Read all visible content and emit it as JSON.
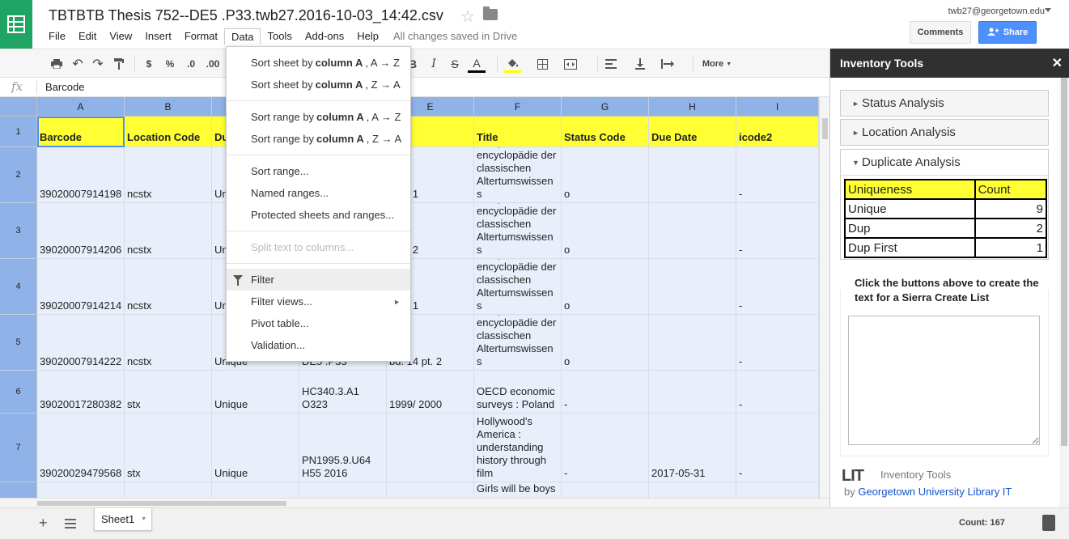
{
  "header": {
    "doc_title": "TBTBTB Thesis 752--DE5 .P33.twb27.2016-10-03_14:42.csv",
    "user_email": "twb27@georgetown.edu",
    "comments_label": "Comments",
    "share_label": "Share",
    "saved_status": "All changes saved in Drive"
  },
  "menu": {
    "items": [
      "File",
      "Edit",
      "View",
      "Insert",
      "Format",
      "Data",
      "Tools",
      "Add-ons",
      "Help"
    ]
  },
  "toolbar": {
    "currency": "$",
    "percent": "%",
    "dec_decrease": ".0",
    "dec_increase": ".00",
    "bold": "B",
    "italic": "I",
    "strike": "S",
    "text_color": "A",
    "more_label": "More"
  },
  "formula_bar": {
    "fx": "fx",
    "value": "Barcode"
  },
  "grid": {
    "columns": [
      "A",
      "B",
      "C",
      "D",
      "E",
      "F",
      "G",
      "H",
      "I"
    ],
    "row_numbers": [
      "1",
      "2",
      "3",
      "4",
      "5",
      "6",
      "7"
    ],
    "headers": [
      "Barcode",
      "Location Code",
      "Du",
      "",
      "me",
      "Title",
      "Status Code",
      "Due Date",
      "icode2"
    ],
    "rows": [
      [
        "39020007914198",
        "ncstx",
        "Uni",
        "",
        "3 pt. 1",
        "Paulys real-encyclopädie der classischen Altertumswissens",
        "o",
        "",
        "-"
      ],
      [
        "39020007914206",
        "ncstx",
        "Un",
        "",
        "3 pt. 2",
        "Paulys real-encyclopädie der classischen Altertumswissens",
        "o",
        "",
        "-"
      ],
      [
        "39020007914214",
        "ncstx",
        "Ur",
        "",
        "4 pt. 1",
        "Paulys real-encyclopädie der classischen Altertumswissens",
        "o",
        "",
        "-"
      ],
      [
        "39020007914222",
        "ncstx",
        "Unique",
        "DE5 .P33",
        "bd. 14 pt. 2",
        "Paulys real-encyclopädie der classischen Altertumswissens",
        "o",
        "",
        "-"
      ],
      [
        "39020017280382",
        "stx",
        "Unique",
        "HC340.3.A1 O323",
        "1999/  2000",
        "OECD economic surveys : Poland",
        "-",
        "",
        "-"
      ],
      [
        "39020029479568",
        "stx",
        "Unique",
        "PN1995.9.U64 H55 2016",
        "",
        "Hollywood's America : understanding history through film",
        "-",
        "2017-05-31",
        "-"
      ],
      [
        "",
        "",
        "",
        "",
        "",
        "Girls will be boys",
        "",
        "",
        ""
      ]
    ]
  },
  "data_menu": {
    "items": [
      {
        "pre": "Sort sheet by ",
        "bold": "column A",
        "post": ", A → Z"
      },
      {
        "pre": "Sort sheet by ",
        "bold": "column A",
        "post": ", Z → A"
      },
      {
        "pre": "Sort range by ",
        "bold": "column A",
        "post": ", A → Z"
      },
      {
        "pre": "Sort range by ",
        "bold": "column A",
        "post": ", Z → A"
      }
    ],
    "sort_range": "Sort range...",
    "named_ranges": "Named ranges...",
    "protected": "Protected sheets and ranges...",
    "split_text": "Split text to columns...",
    "filter": "Filter",
    "filter_views": "Filter views...",
    "pivot_table": "Pivot table...",
    "validation": "Validation..."
  },
  "sidebar": {
    "title": "Inventory Tools",
    "sections": [
      "Status Analysis",
      "Location Analysis",
      "Duplicate Analysis"
    ],
    "dup_table": {
      "header": [
        "Uniqueness",
        "Count"
      ],
      "rows": [
        [
          "Unique",
          "9"
        ],
        [
          "Dup",
          "2"
        ],
        [
          "Dup First",
          "1"
        ]
      ]
    },
    "instructions": "Click the buttons above to create the text for a Sierra Create List",
    "footer_logo": "LIT",
    "footer_name": "Inventory Tools",
    "footer_by": "by ",
    "footer_link": "Georgetown University Library IT"
  },
  "bottom": {
    "sheet_name": "Sheet1",
    "count_status": "Count: 167"
  }
}
